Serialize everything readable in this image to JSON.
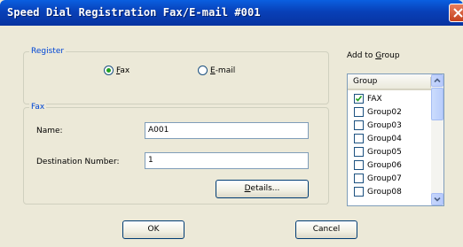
{
  "window": {
    "title": "Speed Dial Registration Fax/E-mail #001"
  },
  "register": {
    "legend": "Register",
    "fax_label": "Fax",
    "fax_underline": "F",
    "email_label": "E-mail",
    "email_underline": "E",
    "selected": "Fax"
  },
  "fax": {
    "legend": "Fax",
    "name_label": "Name:",
    "name_value": "A001",
    "destination_label": "Destination Number:",
    "destination_value": "1",
    "details_label": "Details...",
    "details_underline": "D"
  },
  "add_to_group": {
    "label_prefix": "Add to ",
    "label_underline": "G",
    "label_suffix": "roup",
    "column_header": "Group",
    "groups": [
      {
        "name": "FAX",
        "checked": true
      },
      {
        "name": "Group02",
        "checked": false
      },
      {
        "name": "Group03",
        "checked": false
      },
      {
        "name": "Group04",
        "checked": false
      },
      {
        "name": "Group05",
        "checked": false
      },
      {
        "name": "Group06",
        "checked": false
      },
      {
        "name": "Group07",
        "checked": false
      },
      {
        "name": "Group08",
        "checked": false
      }
    ]
  },
  "buttons": {
    "ok": "OK",
    "cancel": "Cancel"
  },
  "icons": {
    "close": "close-icon",
    "check": "check-icon",
    "scroll_up": "chevron-up-icon",
    "scroll_down": "chevron-down-icon"
  }
}
